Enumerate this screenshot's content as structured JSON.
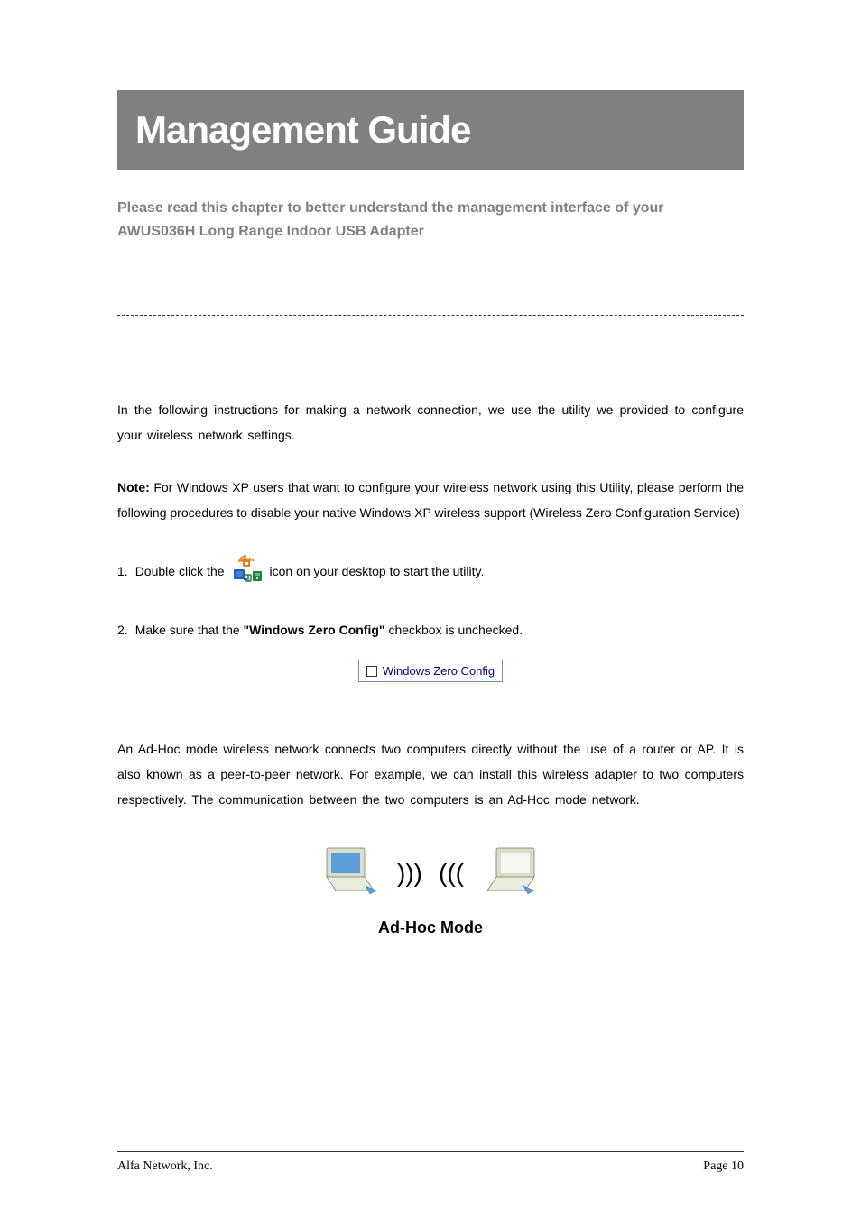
{
  "header": {
    "title": "Management Guide",
    "subtitle": "Please read this chapter to better understand the management interface of your AWUS036H Long Range Indoor USB Adapter"
  },
  "intro": {
    "paragraph": "In the following instructions for making a network connection, we use the utility we provided to configure your wireless network settings."
  },
  "note": {
    "label": "Note:",
    "text": " For Windows XP users that want to configure your wireless network using this Utility, please perform the following procedures to disable your native Windows XP wireless support (Wireless Zero Configuration Service)"
  },
  "steps": {
    "step1": {
      "num": "1.",
      "text_before": "Double click the",
      "text_after": "icon on your desktop to start the utility."
    },
    "step2": {
      "num": "2.",
      "text_before": "Make sure that the ",
      "quoted": "\"Windows Zero Config\"",
      "text_after": " checkbox is unchecked."
    }
  },
  "checkbox": {
    "label": "Windows Zero Config"
  },
  "adhoc": {
    "paragraph": "An Ad-Hoc mode wireless network connects two computers directly without the use of a router or AP.  It is also known as a peer-to-peer network. For example, we can install this wireless adapter to two computers respectively. The communication between the two computers is an Ad-Hoc mode network.",
    "caption": "Ad-Hoc Mode"
  },
  "footer": {
    "company": "Alfa Network, Inc.",
    "page_label": "Page 10"
  }
}
